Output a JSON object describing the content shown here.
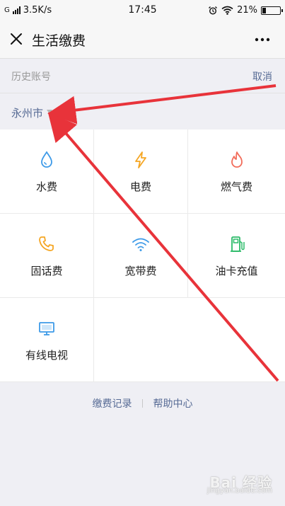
{
  "status_bar": {
    "carrier": "G",
    "speed": "3.5K/s",
    "time": "17:45",
    "battery": "21%",
    "battery_level": 0.21
  },
  "nav": {
    "title": "生活缴费",
    "close_icon": "close-icon",
    "more_icon": "more-icon"
  },
  "history": {
    "label": "历史账号",
    "cancel": "取消"
  },
  "city": {
    "name": "永州市"
  },
  "services": [
    {
      "label": "水费",
      "icon": "water-drop-icon",
      "color": "#3d9ae8"
    },
    {
      "label": "电费",
      "icon": "lightning-icon",
      "color": "#f5a623"
    },
    {
      "label": "燃气费",
      "icon": "flame-icon",
      "color": "#f26c5a"
    },
    {
      "label": "固话费",
      "icon": "phone-icon",
      "color": "#f5a623"
    },
    {
      "label": "宽带费",
      "icon": "wifi-icon",
      "color": "#3d9ae8"
    },
    {
      "label": "油卡充值",
      "icon": "fuel-pump-icon",
      "color": "#2dbb6a"
    },
    {
      "label": "有线电视",
      "icon": "tv-icon",
      "color": "#3d9ae8"
    }
  ],
  "footer": {
    "records": "缴费记录",
    "help": "帮助中心"
  },
  "watermark": {
    "brand": "Bai 经验",
    "sub": "jingyan.baidu.com"
  },
  "colors": {
    "link": "#576b95",
    "annotation_arrow": "#e8333a"
  }
}
